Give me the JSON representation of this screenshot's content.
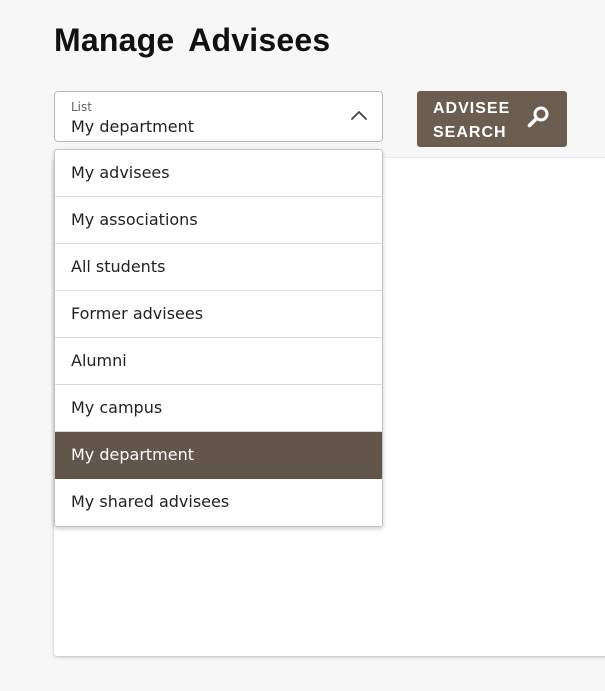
{
  "page": {
    "title": "Manage Advisees"
  },
  "list_select": {
    "label": "List",
    "value": "My department",
    "icon": "chevron-up-icon"
  },
  "search_button": {
    "label": "ADVISEE SEARCH",
    "icon": "search-icon",
    "color": "#6b5d50"
  },
  "dropdown": {
    "options": [
      "My advisees",
      "My associations",
      "All students",
      "Former advisees",
      "Alumni",
      "My campus",
      "My department",
      "My shared advisees"
    ],
    "selected": "My department",
    "selected_color": "#625549"
  }
}
